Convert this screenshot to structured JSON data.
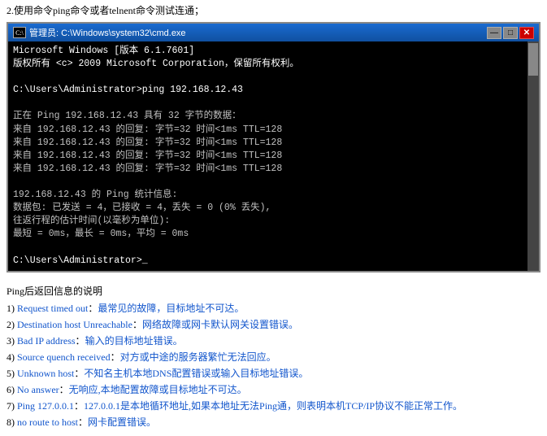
{
  "top_instruction": "2.使用命令ping命令或者telnent命令测试连通；",
  "cmd_window": {
    "title": "管理员: C:\\Windows\\system32\\cmd.exe",
    "content": [
      "Microsoft Windows [版本 6.1.7601]",
      "版权所有 <c> 2009 Microsoft Corporation，保留所有权利。",
      "",
      "C:\\Users\\Administrator>ping 192.168.12.43",
      "",
      "正在 Ping 192.168.12.43 具有 32 字节的数据：",
      "来自 192.168.12.43 的回复: 字节=32 时间<1ms TTL=128",
      "来自 192.168.12.43 的回复: 字节=32 时间<1ms TTL=128",
      "来自 192.168.12.43 的回复: 字节=32 时间<1ms TTL=128",
      "来自 192.168.12.43 的回复: 字节=32 时间<1ms TTL=128",
      "",
      "192.168.12.43 的 Ping 统计信息:",
      "    数据包: 已发送 = 4，已接收 = 4，丢失 = 0 (0% 丢失),",
      "往返行程的估计时间(以毫秒为单位):",
      "    最短 = 0ms，最长 = 0ms，平均 = 0ms",
      "",
      "C:\\Users\\Administrator>_"
    ],
    "buttons": {
      "minimize": "—",
      "maximize": "□",
      "close": "✕"
    }
  },
  "ping_info": {
    "title": "Ping后返回信息的说明",
    "items": [
      {
        "number": "1)",
        "label": "Request timed out",
        "colon": "：",
        "desc": "最常见的故障，目标地址不可达。"
      },
      {
        "number": "2)",
        "label": "Destination host Unreachable",
        "colon": "：",
        "desc": "网络故障或网卡默认网关设置错误。"
      },
      {
        "number": "3)",
        "label": "Bad IP address",
        "colon": "：",
        "desc": "输入的目标地址错误。"
      },
      {
        "number": "4)",
        "label": "Source quench received",
        "colon": "：",
        "desc": "对方或中途的服务器繁忙无法回应。"
      },
      {
        "number": "5)",
        "label": "Unknown host",
        "colon": "：",
        "desc": "不知名主机本地DNS配置错误或输入目标地址错误。"
      },
      {
        "number": "6)",
        "label": "No answer",
        "colon": "：",
        "desc": "无响应,本地配置故障或目标地址不可达。"
      },
      {
        "number": "7)",
        "label": "Ping 127.0.0.1",
        "colon": "：",
        "desc": "127.0.0.1是本地循环地址,如果本地址无法Ping通，则表明本机TCP/IP协议不能正常工作。"
      },
      {
        "number": "8)",
        "label": "no route to host",
        "colon": "：",
        "desc": "网卡配置错误。"
      }
    ]
  }
}
